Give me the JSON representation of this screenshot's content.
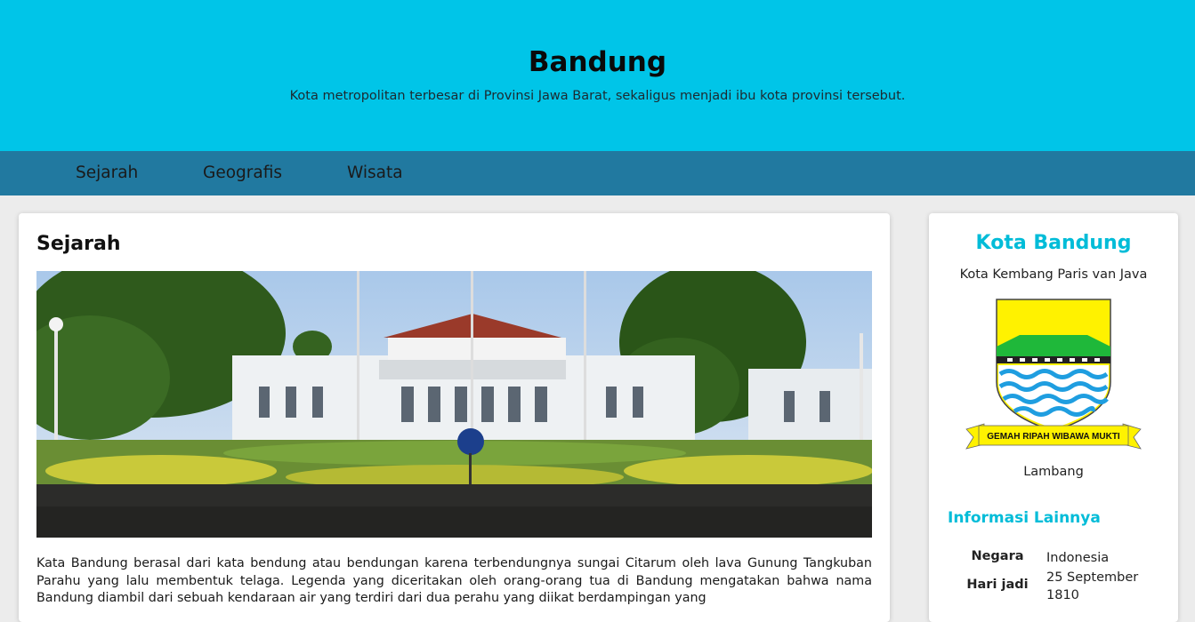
{
  "header": {
    "title": "Bandung",
    "subtitle": "Kota metropolitan terbesar di Provinsi Jawa Barat, sekaligus menjadi ibu kota provinsi tersebut."
  },
  "nav": {
    "items": [
      "Sejarah",
      "Geografis",
      "Wisata"
    ]
  },
  "main": {
    "heading": "Sejarah",
    "image_icon": "gedung-sate-photo",
    "paragraph": "Kata Bandung berasal dari kata bendung atau bendungan karena terbendungnya sungai Citarum oleh lava Gunung Tangkuban Parahu yang lalu membentuk telaga. Legenda yang diceritakan oleh orang-orang tua di Bandung mengatakan bahwa nama Bandung diambil dari sebuah kendaraan air yang terdiri dari dua perahu yang diikat berdampingan yang"
  },
  "sidebar": {
    "title": "Kota Bandung",
    "subtitle": "Kota Kembang Paris van Java",
    "emblem_motto": "GEMAH RIPAH WIBAWA MUKTI",
    "emblem_caption": "Lambang",
    "info_heading": "Informasi Lainnya",
    "info": [
      {
        "label": "Negara",
        "value": "Indonesia"
      },
      {
        "label": "Hari jadi",
        "value": "25 September 1810"
      }
    ]
  },
  "colors": {
    "header_bg": "#00c5e8",
    "nav_bg": "#2179a0",
    "accent": "#00bcd8",
    "page_bg": "#ececec"
  }
}
